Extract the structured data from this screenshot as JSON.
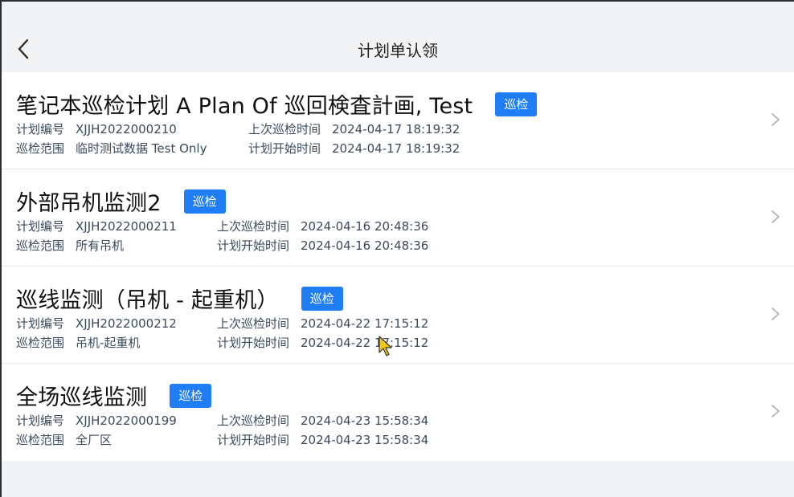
{
  "header": {
    "title": "计划单认领"
  },
  "labels": {
    "plan_no": "计划编号",
    "scope": "巡检范围",
    "last_time": "上次巡检时间",
    "start_time": "计划开始时间"
  },
  "items": [
    {
      "title": "笔记本巡检计划 A Plan Of 巡回検査計画, Test",
      "badge": "巡检",
      "plan_no": "XJJH2022000210",
      "scope": "临时测试数据 Test Only",
      "last_time": "2024-04-17 18:19:32",
      "start_time": "2024-04-17 18:19:32"
    },
    {
      "title": "外部吊机监测2",
      "badge": "巡检",
      "plan_no": "XJJH2022000211",
      "scope": "所有吊机",
      "last_time": "2024-04-16 20:48:36",
      "start_time": "2024-04-16 20:48:36"
    },
    {
      "title": "巡线监测（吊机 - 起重机）",
      "badge": "巡检",
      "plan_no": "XJJH2022000212",
      "scope": "吊机-起重机",
      "last_time": "2024-04-22 17:15:12",
      "start_time": "2024-04-22 17:15:12"
    },
    {
      "title": "全场巡线监测",
      "badge": "巡检",
      "plan_no": "XJJH2022000199",
      "scope": "全厂区",
      "last_time": "2024-04-23 15:58:34",
      "start_time": "2024-04-23 15:58:34"
    }
  ],
  "colors": {
    "badge": "#1f7ef5",
    "background": "#f2f3f5",
    "meta_text": "#3a4a5c"
  },
  "icons": {
    "back": "chevron-left-icon",
    "row_arrow": "chevron-right-icon"
  }
}
